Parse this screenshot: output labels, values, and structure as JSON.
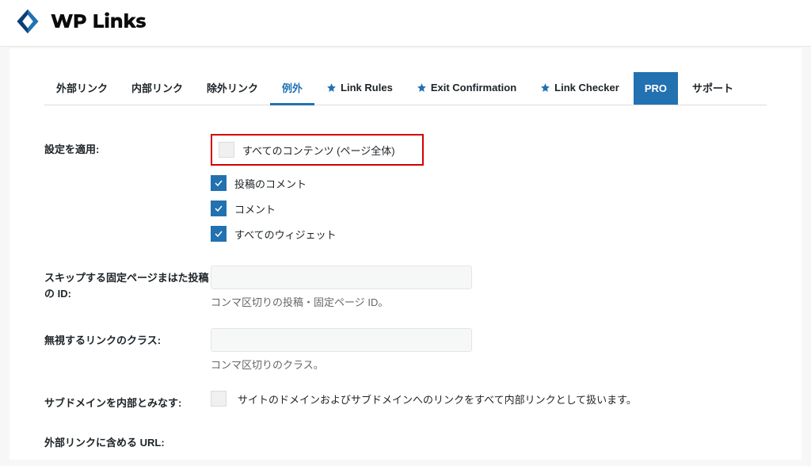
{
  "brand": {
    "name": "WP Links"
  },
  "tabs": [
    {
      "label": "外部リンク"
    },
    {
      "label": "内部リンク"
    },
    {
      "label": "除外リンク"
    },
    {
      "label": "例外",
      "active": true
    },
    {
      "label": "Link Rules",
      "star": true
    },
    {
      "label": "Exit Confirmation",
      "star": true
    },
    {
      "label": "Link Checker",
      "star": true
    },
    {
      "label": "PRO",
      "pro": true
    },
    {
      "label": "サポート"
    }
  ],
  "form": {
    "apply": {
      "label": "設定を適用:",
      "options": {
        "all_content": "すべてのコンテンツ (ページ全体)",
        "post_comments": "投稿のコメント",
        "comments": "コメント",
        "all_widgets": "すべてのウィジェット"
      }
    },
    "skip_ids": {
      "label": "スキップする固定ページまはた投稿の ID:",
      "value": "",
      "helper": "コンマ区切りの投稿・固定ページ ID。"
    },
    "ignore_class": {
      "label": "無視するリンクのクラス:",
      "value": "",
      "helper": "コンマ区切りのクラス。"
    },
    "subdomain_internal": {
      "label": "サブドメインを内部とみなす:",
      "helper": "サイトのドメインおよびサブドメインへのリンクをすべて内部リンクとして扱います。"
    },
    "include_url": {
      "label": "外部リンクに含める URL:"
    }
  }
}
